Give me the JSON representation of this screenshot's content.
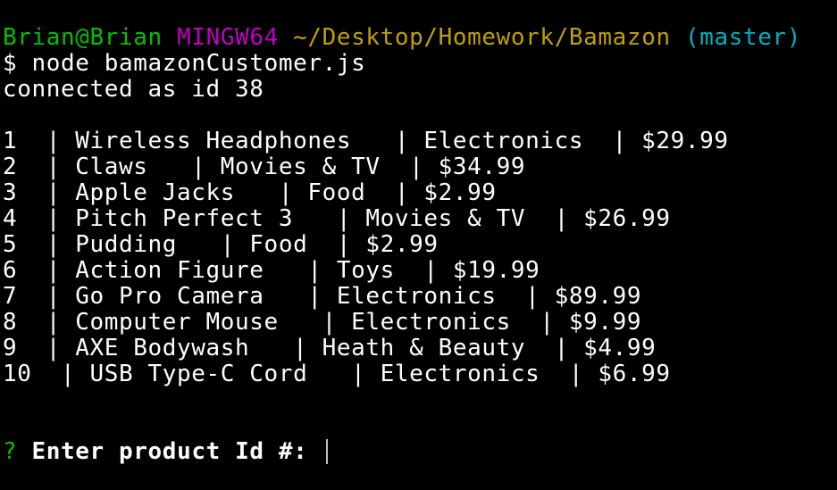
{
  "prompt": {
    "user_host": "Brian@Brian",
    "shell": "MINGW64",
    "path": "~/Desktop/Homework/Bamazon",
    "branch": "(master)",
    "dollar": "$",
    "command": "node bamazonCustomer.js"
  },
  "output": {
    "connected": "connected as id 38"
  },
  "rows": [
    "1  | Wireless Headphones   | Electronics  | $29.99",
    "2  | Claws   | Movies & TV  | $34.99",
    "3  | Apple Jacks   | Food  | $2.99",
    "4  | Pitch Perfect 3   | Movies & TV  | $26.99",
    "5  | Pudding   | Food  | $2.99",
    "6  | Action Figure   | Toys  | $19.99",
    "7  | Go Pro Camera   | Electronics  | $89.99",
    "8  | Computer Mouse   | Electronics  | $9.99",
    "9  | AXE Bodywash   | Heath & Beauty  | $4.99",
    "10  | USB Type-C Cord   | Electronics  | $6.99"
  ],
  "input_prompt": {
    "mark": "?",
    "question": "Enter product Id #:"
  },
  "colors": {
    "background": "#000000",
    "user_host": "#00c000",
    "shell": "#c000c0",
    "path": "#c0a000",
    "branch": "#00b0c0",
    "question_mark": "#00c000"
  }
}
